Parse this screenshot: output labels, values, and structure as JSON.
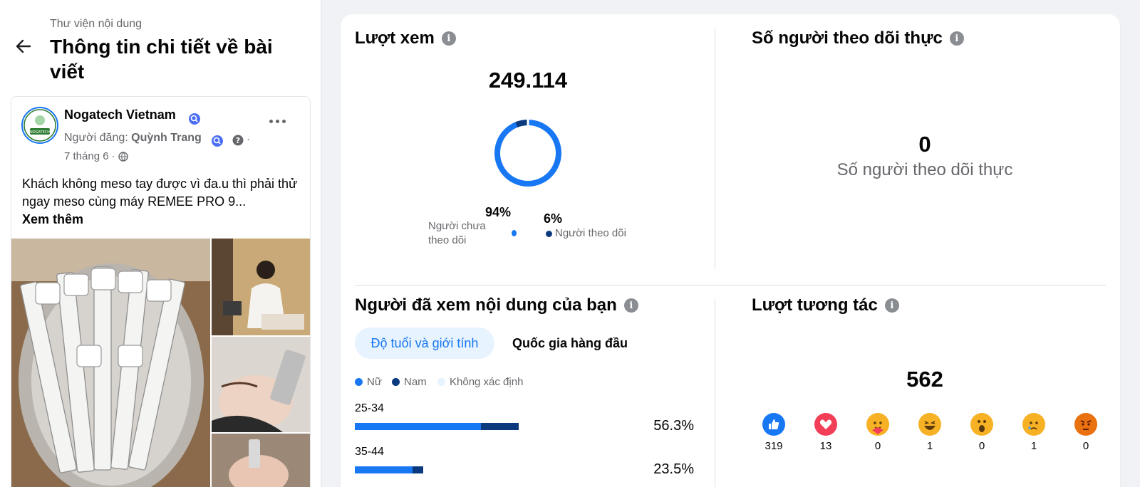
{
  "header": {
    "breadcrumb": "Thư viện nội dung",
    "title": "Thông tin chi tiết về bài viết"
  },
  "post": {
    "page_name": "Nogatech Vietnam",
    "avatar_text": "NOGATECH",
    "poster_label": "Người đăng:",
    "poster_name": "Quỳnh Trang",
    "date": "7 tháng 6",
    "separator": "·",
    "text": "Khách không meso tay được vì đa.u thì phải thử ngay meso cùng máy REMEE PRO 9...",
    "see_more": "Xem thêm"
  },
  "views": {
    "title": "Lượt xem",
    "total": "249.114",
    "non_followers_pct": "94%",
    "non_followers_label": "Người chưa theo dõi",
    "followers_pct": "6%",
    "followers_label": "Người theo dõi"
  },
  "net_follows": {
    "title": "Số người theo dõi thực",
    "value": "0",
    "caption": "Số người theo dõi thực"
  },
  "audience": {
    "title": "Người đã xem nội dung của bạn",
    "tabs": [
      "Độ tuổi và giới tính",
      "Quốc gia hàng đầu"
    ],
    "legend": [
      "Nữ",
      "Nam",
      "Không xác định"
    ],
    "rows": [
      {
        "age": "25-34",
        "pct": "56.3%",
        "female": 0.77,
        "male": 0.23,
        "total": 0.563
      },
      {
        "age": "35-44",
        "pct": "23.5%",
        "female": 0.84,
        "male": 0.16,
        "total": 0.235
      }
    ]
  },
  "interactions": {
    "title": "Lượt tương tác",
    "total": "562",
    "reactions": [
      {
        "name": "like",
        "count": "319"
      },
      {
        "name": "love",
        "count": "13"
      },
      {
        "name": "care",
        "count": "0"
      },
      {
        "name": "haha",
        "count": "1"
      },
      {
        "name": "wow",
        "count": "0"
      },
      {
        "name": "sad",
        "count": "1"
      },
      {
        "name": "angry",
        "count": "0"
      }
    ]
  },
  "colors": {
    "primary": "#1877f2",
    "dark_blue": "#0a3a7d",
    "light_blue": "#e7f3ff",
    "text_secondary": "#65676b"
  }
}
